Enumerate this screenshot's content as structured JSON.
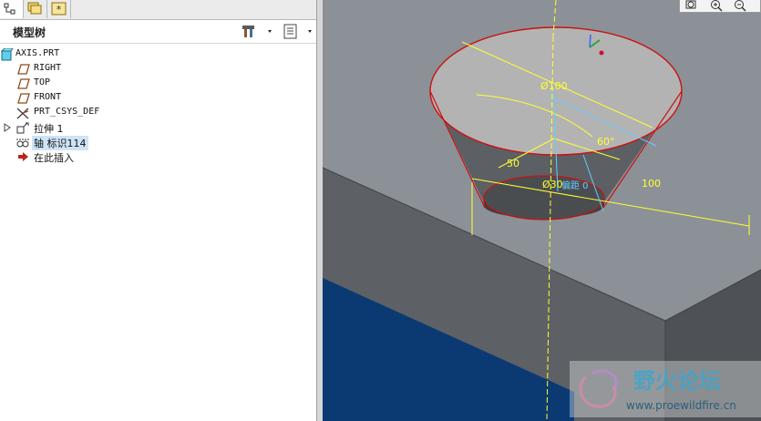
{
  "tabs": [
    {
      "name": "model-tree-tab",
      "icon": "tree-icon"
    },
    {
      "name": "folder-browser-tab",
      "icon": "folders-icon"
    },
    {
      "name": "favorites-tab",
      "icon": "star-folder-icon"
    }
  ],
  "tree": {
    "title": "模型树",
    "items": [
      {
        "label": "AXIS.PRT",
        "icon": "part-icon",
        "expandable": false
      },
      {
        "label": "RIGHT",
        "icon": "datum-plane-icon",
        "expandable": false
      },
      {
        "label": "TOP",
        "icon": "datum-plane-icon",
        "expandable": false
      },
      {
        "label": "FRONT",
        "icon": "datum-plane-icon",
        "expandable": false
      },
      {
        "label": "PRT_CSYS_DEF",
        "icon": "coordinate-system-icon",
        "expandable": false
      },
      {
        "label": "拉伸 1",
        "icon": "extrude-icon",
        "expandable": true
      },
      {
        "label": "轴 标识114",
        "icon": "datum-axis-icon",
        "expandable": false,
        "selected": true
      },
      {
        "label": "在此插入",
        "icon": "insert-here-arrow-icon",
        "expandable": false
      }
    ]
  },
  "viewport": {
    "dimensions": {
      "top_diameter": "Ø100",
      "bottom_diameter": "Ø30",
      "angle": "60°",
      "depth": "50",
      "block_length": "100",
      "offset_label": "偏距 0"
    },
    "toolbar": [
      {
        "name": "zoom-window-icon"
      },
      {
        "name": "zoom-in-icon"
      },
      {
        "name": "zoom-out-icon"
      }
    ],
    "watermark": {
      "title": "野火论坛",
      "url": "www.proewildfire.cn"
    }
  },
  "colors": {
    "viewport_bg": "#7f848a",
    "panel_bg": "#ffffff",
    "dim_yellow": "#ffff33",
    "edge_red": "#cc1111",
    "selection_blue": "#cfe3f7"
  }
}
